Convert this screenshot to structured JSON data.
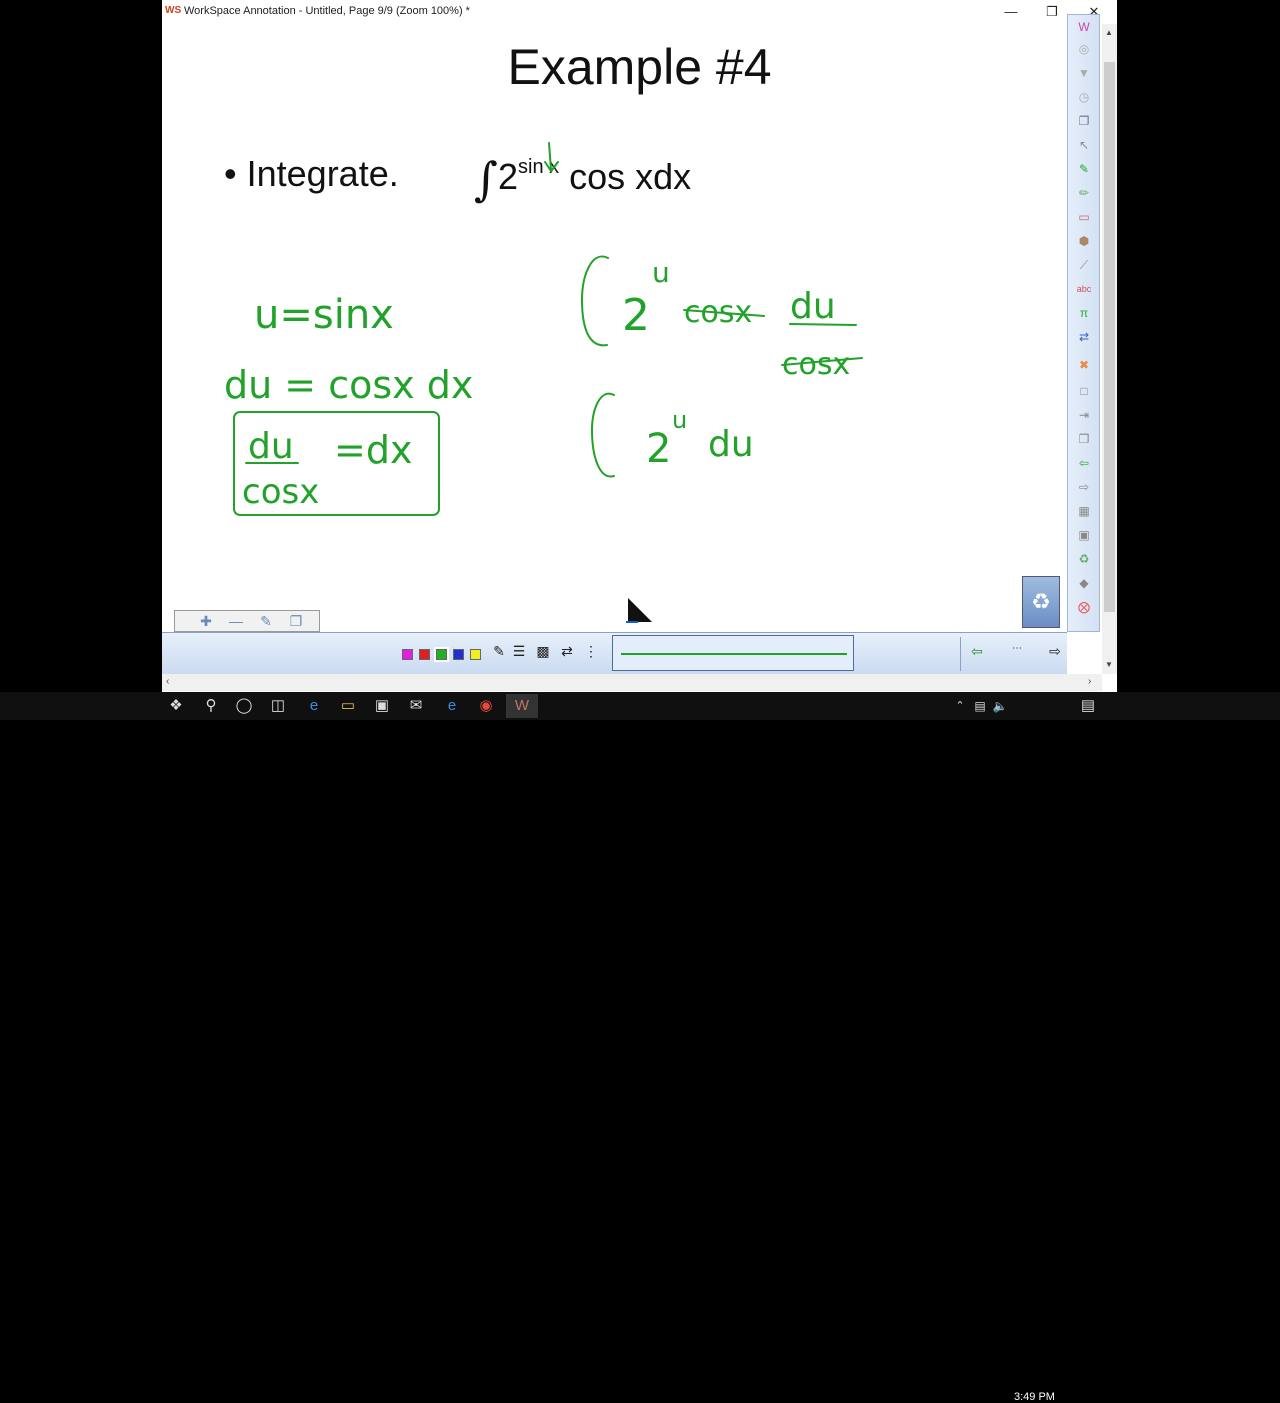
{
  "window": {
    "title": "WorkSpace Annotation - Untitled, Page 9/9  (Zoom 100%) *",
    "logo_text": "WS"
  },
  "slide": {
    "title": "Example #4",
    "bullet_text": "Integrate.",
    "integral": {
      "symbol": "∫",
      "base": "2",
      "exponent": "sin x",
      "rest": "cos xdx"
    }
  },
  "ink": {
    "color": "#22a22a",
    "lines": [
      "u=sinx",
      "du = cosx dx",
      "du",
      "cosx",
      "=dx",
      "2",
      "u",
      "cosx",
      "du",
      "cosx",
      "2",
      "u",
      "du"
    ]
  },
  "taskbar": {
    "clock": "3:49 PM"
  },
  "palette": [
    "#e020e0",
    "#e02020",
    "#20b020",
    "#2030d0",
    "#f0f020"
  ],
  "accent": "#22a22a"
}
